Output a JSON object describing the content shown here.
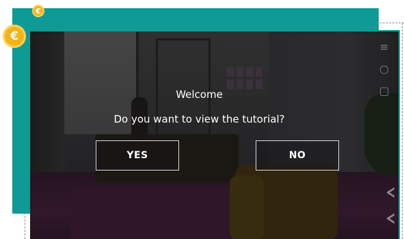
{
  "badges": {
    "small": "€",
    "large": "€"
  },
  "dialog": {
    "title": "Welcome",
    "question": "Do you want to view the tutorial?",
    "yes_label": "YES",
    "no_label": "NO"
  },
  "side_toolbar": {
    "icons": [
      "menu-icon",
      "search-icon",
      "dice-icon"
    ],
    "menu_glyph": "≡",
    "search_glyph": "○",
    "dice_glyph": "▢",
    "chevron_glyph": "‹"
  },
  "colors": {
    "teal": "#0e9a95",
    "badge": "#f3b31a",
    "button_border": "#dcdcdc"
  }
}
